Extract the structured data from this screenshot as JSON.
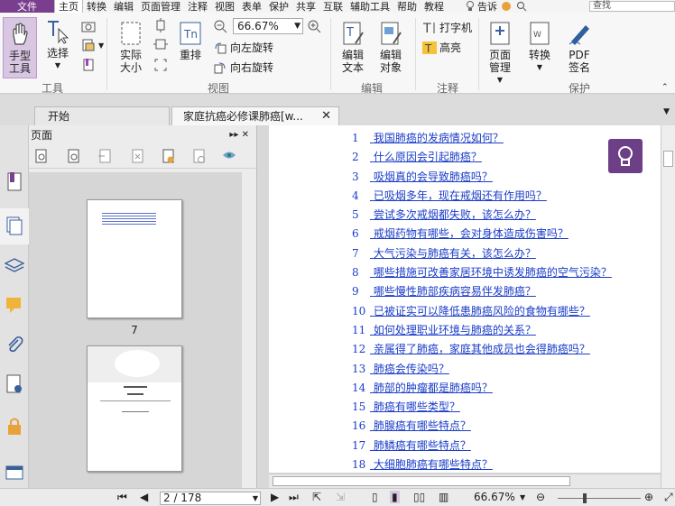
{
  "menubar": {
    "file": "文件",
    "items": [
      "主页",
      "转换",
      "编辑",
      "页面管理",
      "注释",
      "视图",
      "表单",
      "保护",
      "共享",
      "互联",
      "辅助工具",
      "帮助",
      "教程"
    ],
    "tell_me": "告诉",
    "search_placeholder": "查找"
  },
  "ribbon": {
    "hand": "手型\n工具",
    "select": "选择",
    "actual_size": "实际\n大小",
    "reflow": "重排",
    "zoom_value": "66.67%",
    "rotate_left": "向左旋转",
    "rotate_right": "向右旋转",
    "edit_text": "编辑\n文本",
    "edit_object": "编辑\n对象",
    "typewriter": "打字机",
    "highlight": "高亮",
    "page_manage": "页面\n管理",
    "convert": "转换",
    "pdf_sign": "PDF\n签名",
    "groups": {
      "tools": "工具",
      "view": "视图",
      "edit": "编辑",
      "comment": "注释",
      "protect": "保护"
    }
  },
  "tabs": [
    {
      "label": "开始"
    },
    {
      "label": "家庭抗癌必修课肺癌[w..."
    }
  ],
  "panel": {
    "title": "页面",
    "thumb_page_label": "7"
  },
  "toc": [
    {
      "num": "1",
      "text": "我国肺癌的发病情况如何？"
    },
    {
      "num": "2",
      "text": "什么原因会引起肺癌？"
    },
    {
      "num": "3",
      "text": "吸烟真的会导致肺癌吗？"
    },
    {
      "num": "4",
      "text": "已吸烟多年，现在戒烟还有作用吗？"
    },
    {
      "num": "5",
      "text": "尝试多次戒烟都失败，该怎么办？"
    },
    {
      "num": "6",
      "text": "戒烟药物有哪些，会对身体造成伤害吗？"
    },
    {
      "num": "7",
      "text": "大气污染与肺癌有关，该怎么办？"
    },
    {
      "num": "8",
      "text": "哪些措施可改善家居环境中诱发肺癌的空气污染？"
    },
    {
      "num": "9",
      "text": "哪些慢性肺部疾病容易伴发肺癌？"
    },
    {
      "num": "10",
      "text": "已被证实可以降低患肺癌风险的食物有哪些？"
    },
    {
      "num": "11",
      "text": "如何处理职业环境与肺癌的关系？"
    },
    {
      "num": "12",
      "text": "亲属得了肺癌，家庭其他成员也会得肺癌吗？"
    },
    {
      "num": "13",
      "text": "肺癌会传染吗？"
    },
    {
      "num": "14",
      "text": "肺部的肿瘤都是肺癌吗？"
    },
    {
      "num": "15",
      "text": "肺癌有哪些类型？"
    },
    {
      "num": "16",
      "text": "肺腺癌有哪些特点？"
    },
    {
      "num": "17",
      "text": "肺鳞癌有哪些特点？"
    },
    {
      "num": "18",
      "text": "大细胞肺癌有哪些特点？"
    }
  ],
  "status": {
    "page_indicator": "2 / 178",
    "zoom": "66.67%"
  },
  "colors": {
    "brand": "#7a3e8f",
    "link": "#1a3cc8",
    "bulb": "#6d3f86"
  }
}
